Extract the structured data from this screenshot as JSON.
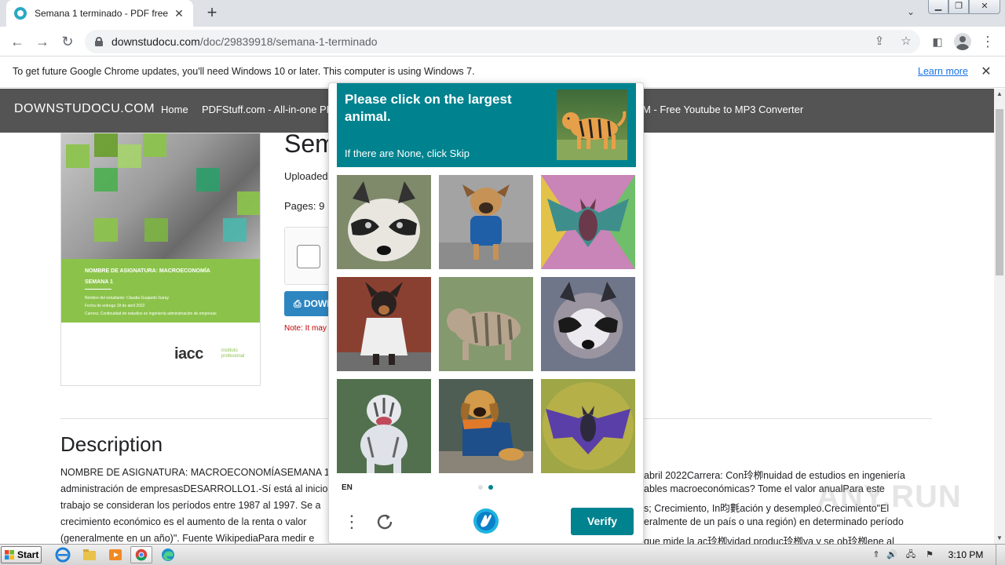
{
  "browser": {
    "tab_title": "Semana 1 terminado - PDF free",
    "url_domain": "downstudocu.com",
    "url_path": "/doc/29839918/semana-1-terminado",
    "infobar_text": "To get future Google Chrome updates, you'll need Windows 10 or later. This computer is using Windows 7.",
    "infobar_link": "Learn more"
  },
  "site": {
    "brand": "DOWNSTUDOCU.COM",
    "nav": [
      "Home",
      "PDFStuff.com - All-in-one PDF",
      "M - Free Youtube to MP3 Converter"
    ],
    "doc_title": "Sem",
    "uploaded": "Uploaded",
    "pages": "Pages: 9",
    "download": "DOWN",
    "note": "Note: It may"
  },
  "cover": {
    "title": "NOMBRE DE ASIGNATURA: MACROECONOMÍA",
    "week": "SEMANA 1",
    "lines": [
      "Nombre del estudiante: Claudia Guajardo Garay",
      "Fecha de entrega 18 de abril 2022",
      "Carrera: Continuidad de estudios en ingeniería administración de empresas"
    ],
    "logo": "iacc",
    "logo_sub": "instituto profesional"
  },
  "description": {
    "heading": "Description",
    "left_lines": [
      "NOMBRE DE ASIGNATURA: MACROECONOMÍASEMANA 1Nor",
      "administración de empresasDESARROLLO1.-Sí está al inicio",
      "trabajo se consideran los períodos entre 1987 al 1997. Se a",
      "crecimiento económico es el aumento de la renta o valor",
      "(generalmente en un año)\". Fuente WikipediaPara medir e"
    ],
    "right_lines": [
      "abril 2022Carrera: Con玲栁nuidad de estudios en ingeniería",
      "ables macroeconómicas? Tome el valor anualPara este",
      "s; Crecimiento, In昀氀ación y desempleo.Crecimiento\"El",
      "eralmente de un país o una región) en determinado período",
      "que mide la ac玲栁vidad produc玲栁va y se ob玲栁ene al"
    ]
  },
  "captcha": {
    "prompt": "Please click on the largest animal.",
    "hint": "If there are None, click Skip",
    "example": "tiger",
    "tiles": [
      "raccoon",
      "dog",
      "bat",
      "dog",
      "tiger",
      "raccoon",
      "tiger",
      "dog",
      "bat"
    ],
    "language": "EN",
    "verify_label": "Verify",
    "page_dots": 2,
    "active_dot": 1
  },
  "taskbar": {
    "start": "Start",
    "clock": "3:10 PM"
  },
  "watermark": "ANY.RUN",
  "colors": {
    "captcha_teal": "#00838f",
    "site_nav": "#545454",
    "cover_green": "#8bc34a",
    "link_blue": "#1a73e8",
    "note_red": "#c00000",
    "download_blue": "#2e86c1"
  }
}
